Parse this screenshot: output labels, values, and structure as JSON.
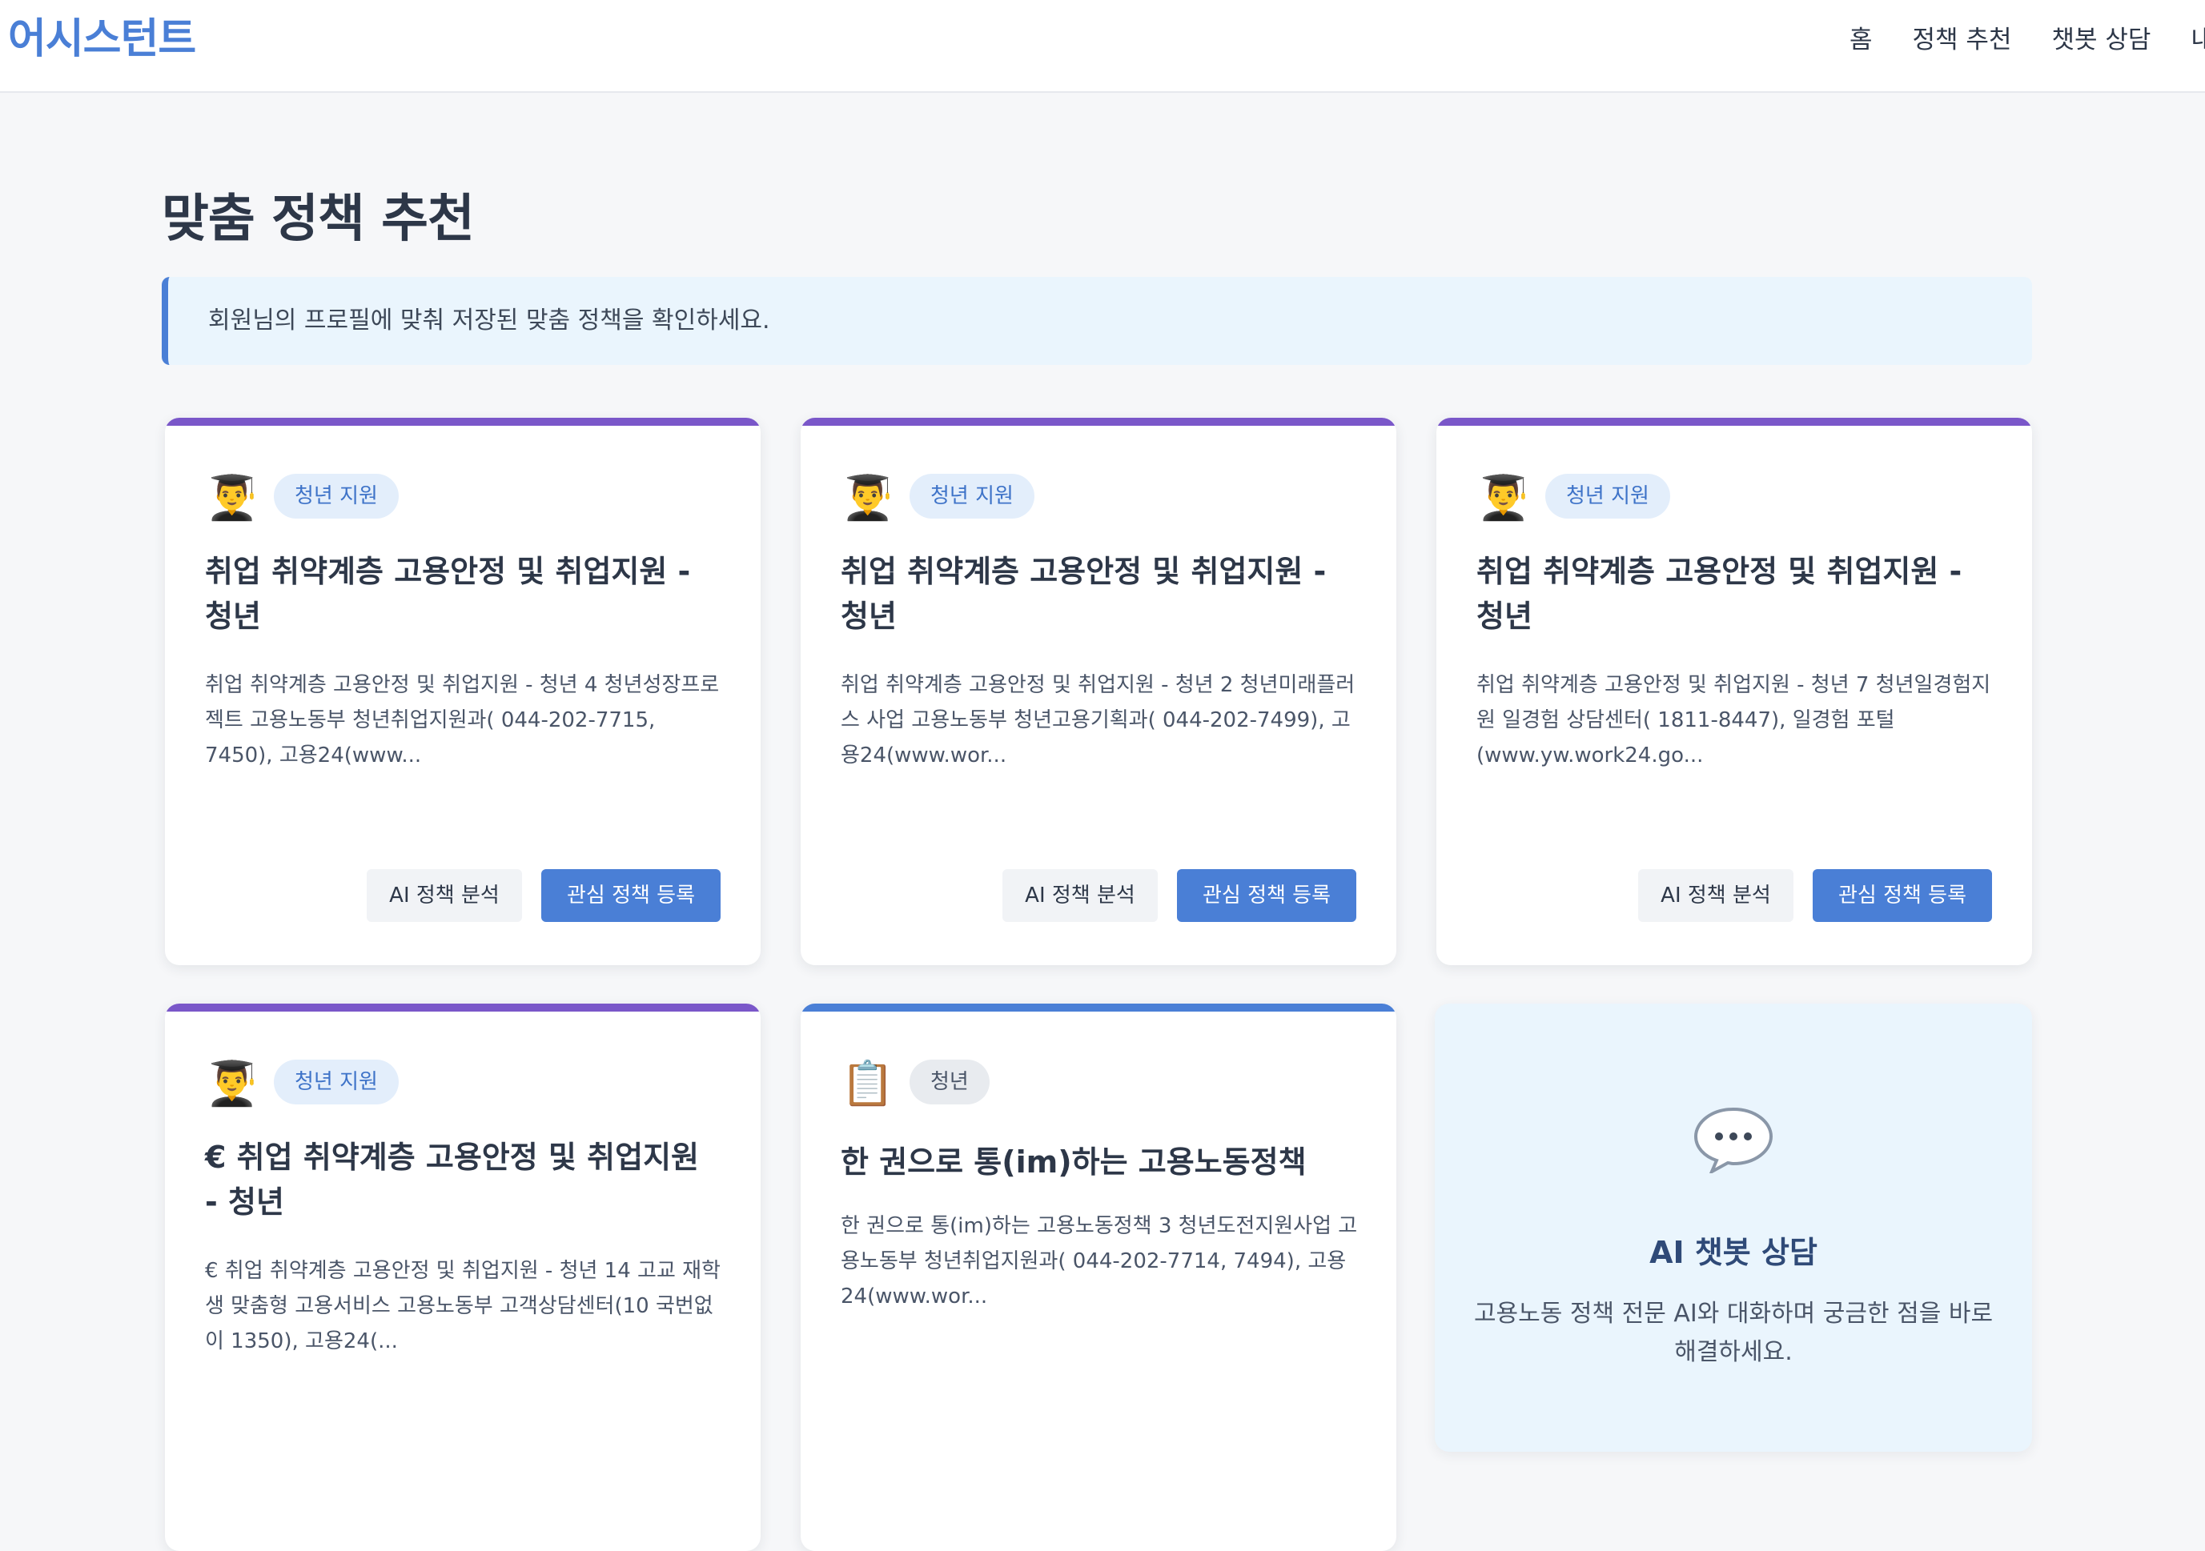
{
  "header": {
    "brand": "어시스턴트",
    "nav": [
      "홈",
      "정책 추천",
      "챗봇 상담",
      "내"
    ]
  },
  "page": {
    "title": "맞춤 정책 추천",
    "info": "회원님의 프로필에 맞춰 저장된 맞춤 정책을 확인하세요."
  },
  "cards": [
    {
      "icon": "graduate-emoji",
      "emoji": "👨‍🎓",
      "tag": "청년 지원",
      "title": "취업 취약계층 고용안정 및 취업지원 - 청년",
      "desc": "취업 취약계층 고용안정 및 취업지원 - 청년 4 청년성장프로젝트 고용노동부 청년취업지원과( 044-202-7715, 7450), 고용24(www...",
      "ai_label": "AI 정책 분석",
      "fav_label": "관심 정책 등록"
    },
    {
      "icon": "graduate-emoji",
      "emoji": "👨‍🎓",
      "tag": "청년 지원",
      "title": "취업 취약계층 고용안정 및 취업지원 - 청년",
      "desc": "취업 취약계층 고용안정 및 취업지원 - 청년 2 청년미래플러스 사업 고용노동부 청년고용기획과( 044-202-7499), 고용24(www.wor...",
      "ai_label": "AI 정책 분석",
      "fav_label": "관심 정책 등록"
    },
    {
      "icon": "graduate-emoji",
      "emoji": "👨‍🎓",
      "tag": "청년 지원",
      "title": "취업 취약계층 고용안정 및 취업지원 - 청년",
      "desc": "취업 취약계층 고용안정 및 취업지원 - 청년 7 청년일경험지원 일경험 상담센터( 1811-8447), 일경험 포털(www.yw.work24.go...",
      "ai_label": "AI 정책 분석",
      "fav_label": "관심 정책 등록"
    },
    {
      "icon": "graduate-emoji",
      "emoji": "👨‍🎓",
      "tag": "청년 지원",
      "title": "€ 취업 취약계층 고용안정 및 취업지원 - 청년",
      "desc": "€ 취업 취약계층 고용안정 및 취업지원 - 청년 14 고교 재학생 맞춤형 고용서비스 고용노동부 고객상담센터(10 국번없이 1350), 고용24(..."
    },
    {
      "icon": "clipboard-emoji",
      "emoji": "📋",
      "tag": "청년",
      "title": "한 권으로 통(im)하는 고용노동정책",
      "desc": "한 권으로 통(im)하는 고용노동정책 3 청년도전지원사업 고용노동부 청년취업지원과( 044-202-7714, 7494), 고용24(www.wor..."
    }
  ],
  "chat": {
    "icon": "speech-bubble-icon",
    "title": "AI 챗봇 상담",
    "desc": "고용노동 정책 전문 AI와 대화하며 궁금한 점을 바로 해결하세요."
  },
  "colors": {
    "accent": "#4a7fd6",
    "purple": "#7a57c9",
    "background": "#f6f7f9"
  }
}
